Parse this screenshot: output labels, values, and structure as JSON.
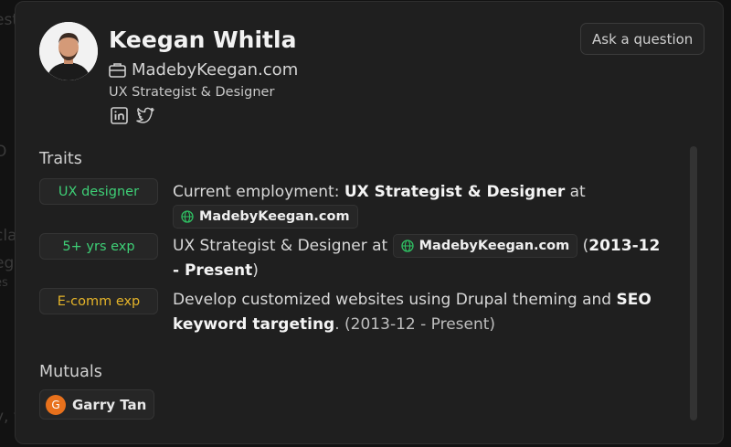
{
  "profile": {
    "name": "Keegan Whitla",
    "website": "MadebyKeegan.com",
    "role": "UX Strategist & Designer",
    "social_icons": [
      "linkedin-icon",
      "twitter-icon"
    ]
  },
  "ask_button": "Ask a question",
  "traits_section": {
    "title": "Traits",
    "items": [
      {
        "badge": "UX designer",
        "color": "#3ecf76"
      },
      {
        "badge": "5+ yrs exp",
        "color": "#3ecf76"
      },
      {
        "badge": "E-comm exp",
        "color": "#e5b429"
      }
    ],
    "t1": {
      "prefix": "Current employment: ",
      "role": "UX Strategist & Designer",
      "at": " at",
      "chip": "MadebyKeegan.com"
    },
    "t2": {
      "prefix": "UX Strategist & Designer at ",
      "chip": "MadebyKeegan.com",
      "open": " (",
      "dates": "2013-12 - Present",
      "close": ")"
    },
    "t3": {
      "prefix": "Develop customized websites using Drupal theming and ",
      "bold": "SEO keyword targeting",
      "suffix": ". (2013-12 - Present)"
    }
  },
  "mutuals_section": {
    "title": "Mutuals",
    "items": [
      {
        "initial": "G",
        "name": "Garry Tan",
        "color": "#e8711c"
      }
    ]
  },
  "background_fragments": [
    "est",
    "O",
    "cla",
    "eg",
    "es",
    "y, t"
  ]
}
